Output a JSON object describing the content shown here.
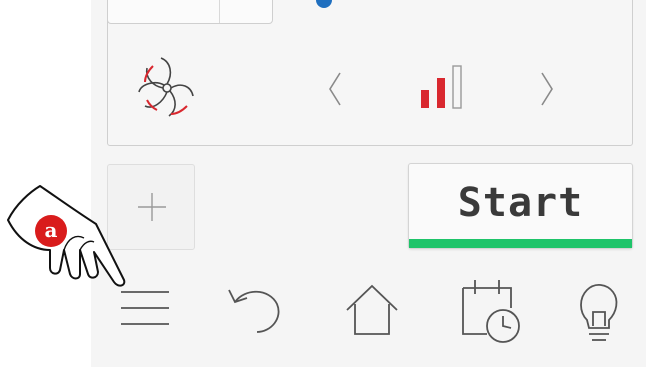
{
  "start_button": {
    "label": "Start",
    "accent_color": "#1fc46a"
  },
  "fan": {
    "icon": "fan-icon",
    "speed_level": 2,
    "speed_max": 3,
    "level_color": "#d9282f"
  },
  "icons": {
    "prev": "chevron-left-icon",
    "next": "chevron-right-icon",
    "add": "plus-icon",
    "menu": "hamburger-menu-icon",
    "undo": "undo-icon",
    "home": "home-icon",
    "schedule": "calendar-clock-icon",
    "tips": "lightbulb-icon"
  },
  "annotation": {
    "label": "a",
    "color": "#d91c1c"
  }
}
